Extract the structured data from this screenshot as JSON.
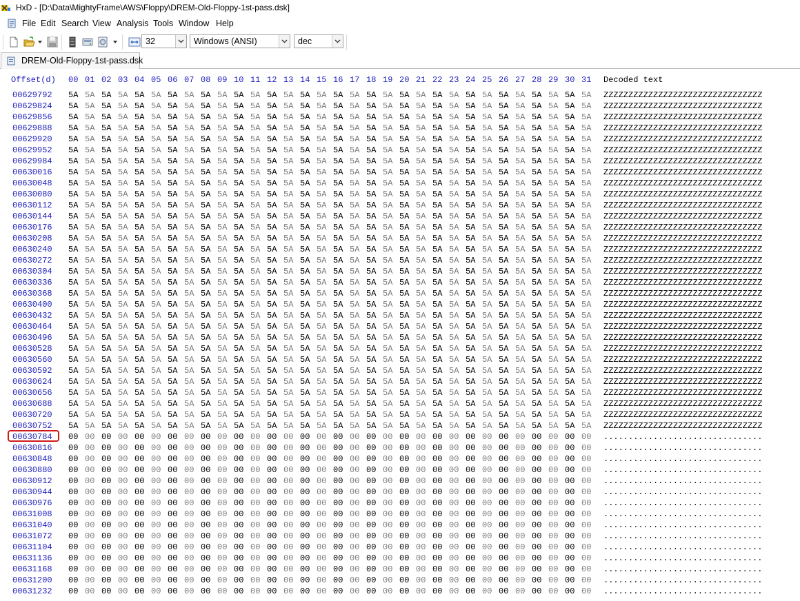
{
  "window": {
    "title": "HxD - [D:\\Data\\MightyFrame\\AWS\\Floppy\\DREM-Old-Floppy-1st-pass.dsk]",
    "app_icon": "hxd-app-icon"
  },
  "menu": {
    "items": [
      "File",
      "Edit",
      "Search",
      "View",
      "Analysis",
      "Tools",
      "Window",
      "Help"
    ]
  },
  "toolbar": {
    "buttons": [
      "new-file-icon",
      "open-file-icon",
      "save-icon",
      "ram-icon",
      "disk-icon",
      "disk-image-icon"
    ],
    "bytes_per_row": "32",
    "charset": "Windows (ANSI)",
    "offset_base": "dec"
  },
  "tab": {
    "label": "DREM-Old-Floppy-1st-pass.dsk"
  },
  "hex": {
    "offset_header": "Offset(d)",
    "column_headers": [
      "00",
      "01",
      "02",
      "03",
      "04",
      "05",
      "06",
      "07",
      "08",
      "09",
      "10",
      "11",
      "12",
      "13",
      "14",
      "15",
      "16",
      "17",
      "18",
      "19",
      "20",
      "21",
      "22",
      "23",
      "24",
      "25",
      "26",
      "27",
      "28",
      "29",
      "30",
      "31"
    ],
    "decoded_header": "Decoded text",
    "rows": [
      {
        "offset": "00629792",
        "byte": "5A",
        "text": "ZZZZZZZZZZZZZZZZZZZZZZZZZZZZZZZZ"
      },
      {
        "offset": "00629824",
        "byte": "5A",
        "text": "ZZZZZZZZZZZZZZZZZZZZZZZZZZZZZZZZ"
      },
      {
        "offset": "00629856",
        "byte": "5A",
        "text": "ZZZZZZZZZZZZZZZZZZZZZZZZZZZZZZZZ"
      },
      {
        "offset": "00629888",
        "byte": "5A",
        "text": "ZZZZZZZZZZZZZZZZZZZZZZZZZZZZZZZZ"
      },
      {
        "offset": "00629920",
        "byte": "5A",
        "text": "ZZZZZZZZZZZZZZZZZZZZZZZZZZZZZZZZ"
      },
      {
        "offset": "00629952",
        "byte": "5A",
        "text": "ZZZZZZZZZZZZZZZZZZZZZZZZZZZZZZZZ"
      },
      {
        "offset": "00629984",
        "byte": "5A",
        "text": "ZZZZZZZZZZZZZZZZZZZZZZZZZZZZZZZZ"
      },
      {
        "offset": "00630016",
        "byte": "5A",
        "text": "ZZZZZZZZZZZZZZZZZZZZZZZZZZZZZZZZ"
      },
      {
        "offset": "00630048",
        "byte": "5A",
        "text": "ZZZZZZZZZZZZZZZZZZZZZZZZZZZZZZZZ"
      },
      {
        "offset": "00630080",
        "byte": "5A",
        "text": "ZZZZZZZZZZZZZZZZZZZZZZZZZZZZZZZZ"
      },
      {
        "offset": "00630112",
        "byte": "5A",
        "text": "ZZZZZZZZZZZZZZZZZZZZZZZZZZZZZZZZ"
      },
      {
        "offset": "00630144",
        "byte": "5A",
        "text": "ZZZZZZZZZZZZZZZZZZZZZZZZZZZZZZZZ"
      },
      {
        "offset": "00630176",
        "byte": "5A",
        "text": "ZZZZZZZZZZZZZZZZZZZZZZZZZZZZZZZZ"
      },
      {
        "offset": "00630208",
        "byte": "5A",
        "text": "ZZZZZZZZZZZZZZZZZZZZZZZZZZZZZZZZ"
      },
      {
        "offset": "00630240",
        "byte": "5A",
        "text": "ZZZZZZZZZZZZZZZZZZZZZZZZZZZZZZZZ"
      },
      {
        "offset": "00630272",
        "byte": "5A",
        "text": "ZZZZZZZZZZZZZZZZZZZZZZZZZZZZZZZZ"
      },
      {
        "offset": "00630304",
        "byte": "5A",
        "text": "ZZZZZZZZZZZZZZZZZZZZZZZZZZZZZZZZ"
      },
      {
        "offset": "00630336",
        "byte": "5A",
        "text": "ZZZZZZZZZZZZZZZZZZZZZZZZZZZZZZZZ"
      },
      {
        "offset": "00630368",
        "byte": "5A",
        "text": "ZZZZZZZZZZZZZZZZZZZZZZZZZZZZZZZZ"
      },
      {
        "offset": "00630400",
        "byte": "5A",
        "text": "ZZZZZZZZZZZZZZZZZZZZZZZZZZZZZZZZ"
      },
      {
        "offset": "00630432",
        "byte": "5A",
        "text": "ZZZZZZZZZZZZZZZZZZZZZZZZZZZZZZZZ"
      },
      {
        "offset": "00630464",
        "byte": "5A",
        "text": "ZZZZZZZZZZZZZZZZZZZZZZZZZZZZZZZZ"
      },
      {
        "offset": "00630496",
        "byte": "5A",
        "text": "ZZZZZZZZZZZZZZZZZZZZZZZZZZZZZZZZ"
      },
      {
        "offset": "00630528",
        "byte": "5A",
        "text": "ZZZZZZZZZZZZZZZZZZZZZZZZZZZZZZZZ"
      },
      {
        "offset": "00630560",
        "byte": "5A",
        "text": "ZZZZZZZZZZZZZZZZZZZZZZZZZZZZZZZZ"
      },
      {
        "offset": "00630592",
        "byte": "5A",
        "text": "ZZZZZZZZZZZZZZZZZZZZZZZZZZZZZZZZ"
      },
      {
        "offset": "00630624",
        "byte": "5A",
        "text": "ZZZZZZZZZZZZZZZZZZZZZZZZZZZZZZZZ"
      },
      {
        "offset": "00630656",
        "byte": "5A",
        "text": "ZZZZZZZZZZZZZZZZZZZZZZZZZZZZZZZZ"
      },
      {
        "offset": "00630688",
        "byte": "5A",
        "text": "ZZZZZZZZZZZZZZZZZZZZZZZZZZZZZZZZ"
      },
      {
        "offset": "00630720",
        "byte": "5A",
        "text": "ZZZZZZZZZZZZZZZZZZZZZZZZZZZZZZZZ"
      },
      {
        "offset": "00630752",
        "byte": "5A",
        "text": "ZZZZZZZZZZZZZZZZZZZZZZZZZZZZZZZZ"
      },
      {
        "offset": "00630784",
        "byte": "00",
        "text": "................................",
        "highlighted": true
      },
      {
        "offset": "00630816",
        "byte": "00",
        "text": "................................"
      },
      {
        "offset": "00630848",
        "byte": "00",
        "text": "................................"
      },
      {
        "offset": "00630880",
        "byte": "00",
        "text": "................................"
      },
      {
        "offset": "00630912",
        "byte": "00",
        "text": "................................"
      },
      {
        "offset": "00630944",
        "byte": "00",
        "text": "................................"
      },
      {
        "offset": "00630976",
        "byte": "00",
        "text": "................................"
      },
      {
        "offset": "00631008",
        "byte": "00",
        "text": "................................"
      },
      {
        "offset": "00631040",
        "byte": "00",
        "text": "................................"
      },
      {
        "offset": "00631072",
        "byte": "00",
        "text": "................................"
      },
      {
        "offset": "00631104",
        "byte": "00",
        "text": "................................"
      },
      {
        "offset": "00631136",
        "byte": "00",
        "text": "................................"
      },
      {
        "offset": "00631168",
        "byte": "00",
        "text": "................................"
      },
      {
        "offset": "00631200",
        "byte": "00",
        "text": "................................"
      },
      {
        "offset": "00631232",
        "byte": "00",
        "text": "................................"
      }
    ]
  },
  "colors": {
    "offset_blue": "#1d1dbd",
    "highlight_red": "#d01818",
    "alt_column_gray": "#7a7a7a"
  }
}
